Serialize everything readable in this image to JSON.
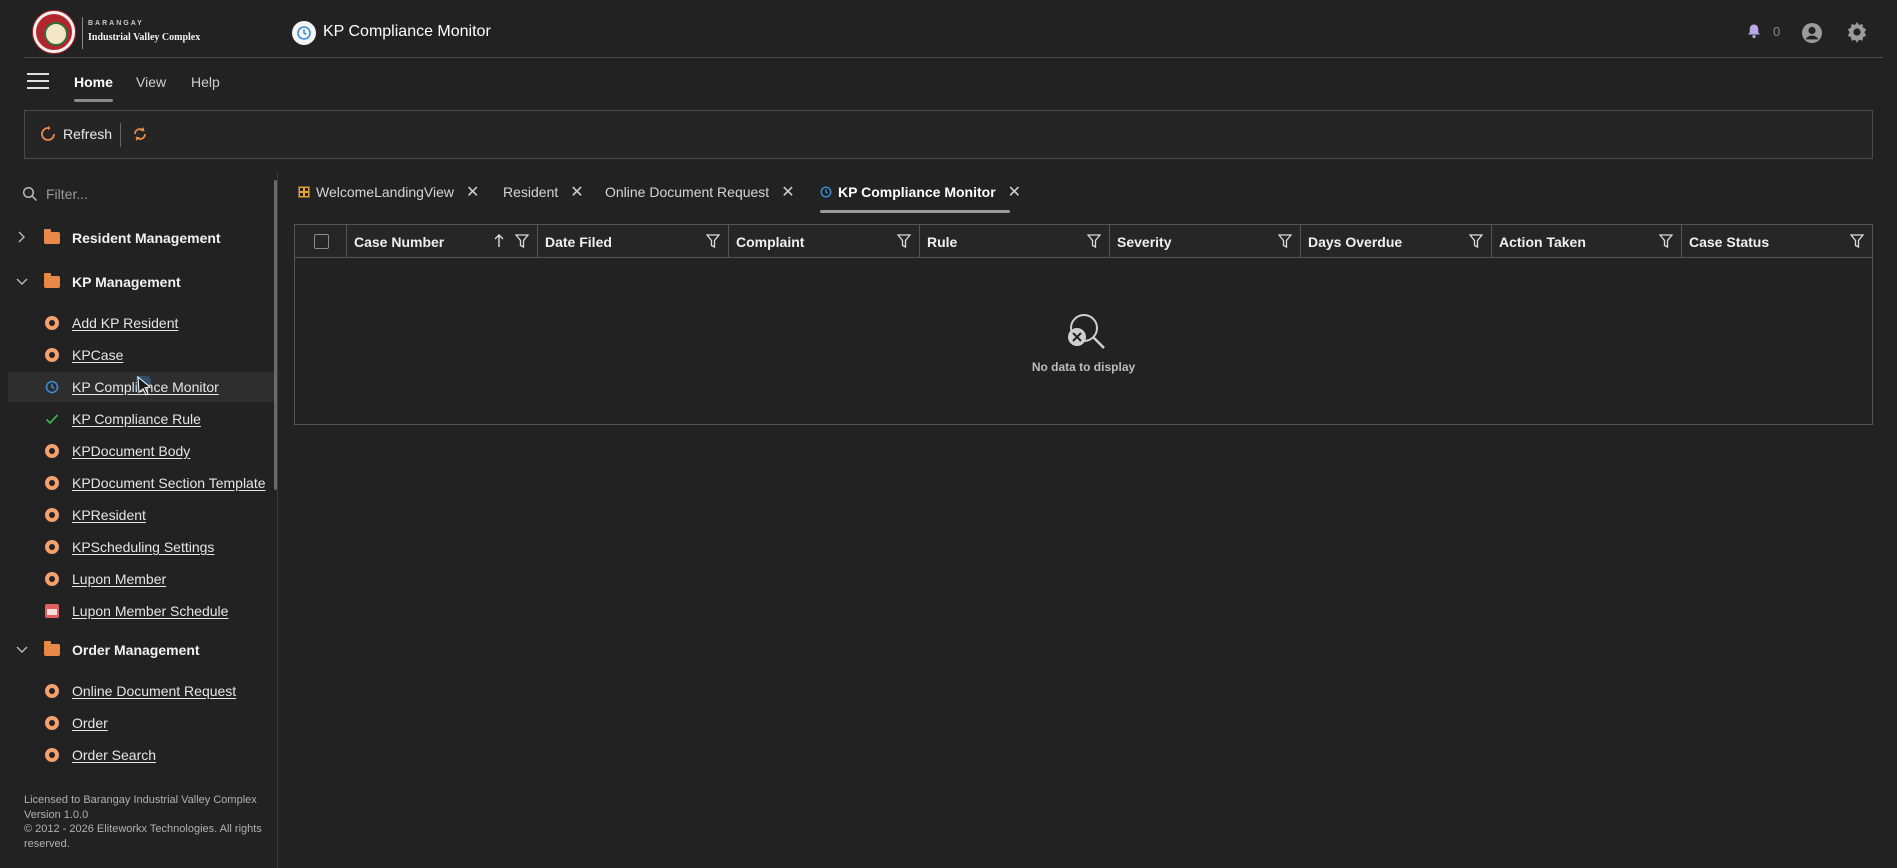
{
  "brand": {
    "top": "BARANGAY",
    "name": "Industrial Valley Complex"
  },
  "app": {
    "title": "KP Compliance Monitor"
  },
  "header": {
    "notification_count": "0",
    "icons": [
      "bell-icon",
      "user-icon",
      "gear-icon"
    ]
  },
  "ribbon": {
    "tabs": [
      {
        "label": "Home",
        "active": true
      },
      {
        "label": "View"
      },
      {
        "label": "Help"
      }
    ]
  },
  "toolbar": {
    "refresh_label": "Refresh"
  },
  "sidebar": {
    "filter_placeholder": "Filter...",
    "groups": [
      {
        "label": "Resident Management",
        "expanded": false
      },
      {
        "label": "KP Management",
        "expanded": true
      },
      {
        "label": "Order Management",
        "expanded": true
      }
    ],
    "kp_items": [
      {
        "label": "Add KP Resident",
        "icon": "gear-icon"
      },
      {
        "label": "KPCase",
        "icon": "gear-icon"
      },
      {
        "label": "KP Compliance Monitor",
        "icon": "clock-icon",
        "selected": true
      },
      {
        "label": "KP Compliance Rule",
        "icon": "check-icon"
      },
      {
        "label": "KPDocument Body",
        "icon": "gear-icon"
      },
      {
        "label": "KPDocument Section Template",
        "icon": "gear-icon"
      },
      {
        "label": "KPResident",
        "icon": "gear-icon"
      },
      {
        "label": "KPScheduling Settings",
        "icon": "gear-icon"
      },
      {
        "label": "Lupon Member",
        "icon": "gear-icon"
      },
      {
        "label": "Lupon Member Schedule",
        "icon": "calendar-icon"
      }
    ],
    "order_items": [
      {
        "label": "Online Document Request",
        "icon": "gear-icon"
      },
      {
        "label": "Order",
        "icon": "gear-icon"
      },
      {
        "label": "Order Search",
        "icon": "gear-icon"
      }
    ],
    "footer": {
      "license": "Licensed to Barangay Industrial Valley Complex",
      "version": "Version 1.0.0",
      "copyright": "© 2012 - 2026 Eliteworkx Technologies. All rights reserved."
    }
  },
  "doc_tabs": [
    {
      "label": "WelcomeLandingView"
    },
    {
      "label": "Resident"
    },
    {
      "label": "Online Document Request"
    },
    {
      "label": "KP Compliance Monitor",
      "active": true
    }
  ],
  "grid": {
    "columns": [
      "Case Number",
      "Date Filed",
      "Complaint",
      "Rule",
      "Severity",
      "Days Overdue",
      "Action Taken",
      "Case Status"
    ],
    "empty_text": "No data to display"
  },
  "colors": {
    "accent_orange": "#e8894a",
    "accent_blue": "#3b8fd9",
    "check_green": "#3bb34a"
  }
}
